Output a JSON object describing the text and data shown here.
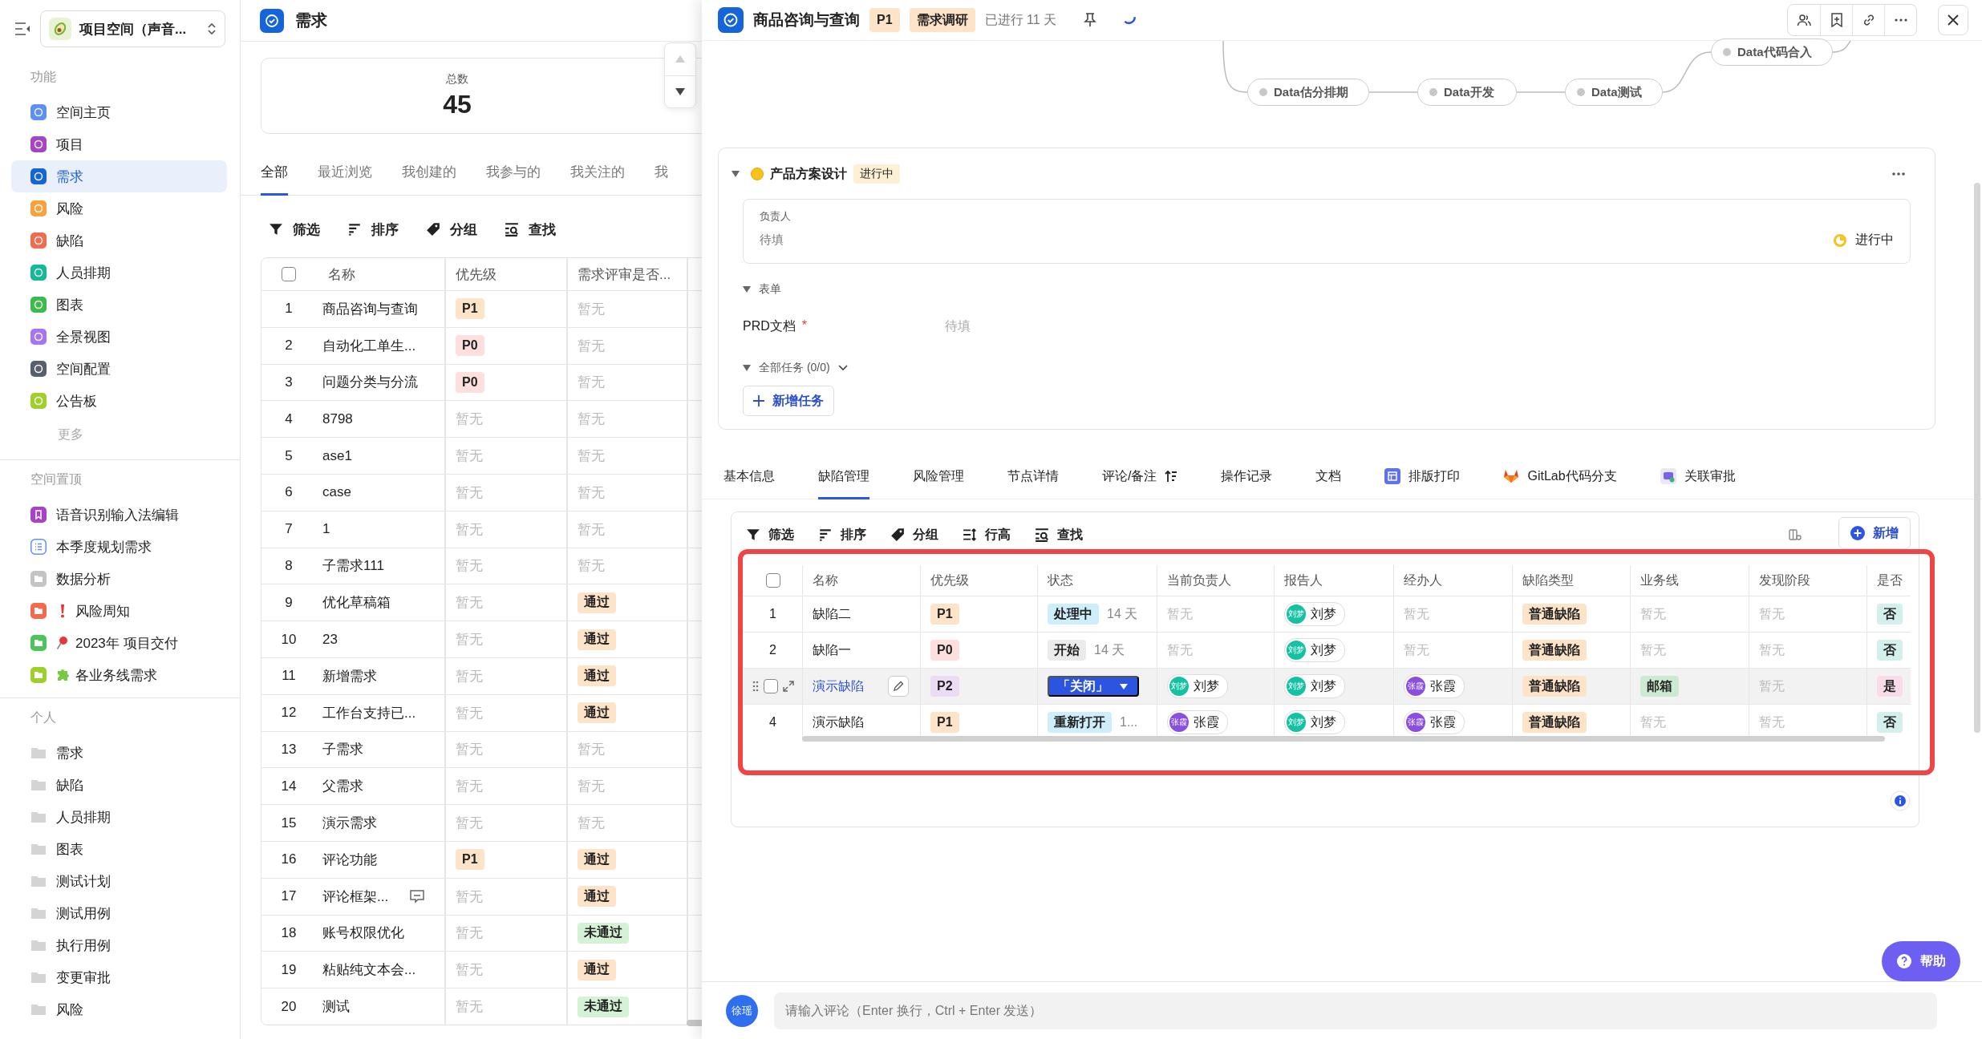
{
  "sidebar": {
    "space_selector": "项目空间（声音...",
    "sections": [
      {
        "title": "功能",
        "more": "更多",
        "items": [
          {
            "label": "空间主页",
            "kind": "tile",
            "color": "#5b8ff9",
            "selected": false
          },
          {
            "label": "项目",
            "kind": "tile",
            "color": "#a446c4",
            "selected": false
          },
          {
            "label": "需求",
            "kind": "tile",
            "color": "#1664d9",
            "selected": true
          },
          {
            "label": "风险",
            "kind": "tile",
            "color": "#f7a23b",
            "selected": false
          },
          {
            "label": "缺陷",
            "kind": "tile",
            "color": "#f26b4f",
            "selected": false
          },
          {
            "label": "人员排期",
            "kind": "tile",
            "color": "#17b89a",
            "selected": false
          },
          {
            "label": "图表",
            "kind": "tile",
            "color": "#3dbb4a",
            "selected": false
          },
          {
            "label": "全景视图",
            "kind": "tile",
            "color": "#a775f2",
            "selected": false
          },
          {
            "label": "空间配置",
            "kind": "tile",
            "color": "#555f6d",
            "selected": false
          },
          {
            "label": "公告板",
            "kind": "tile",
            "color": "#9fcf2b",
            "selected": false
          }
        ]
      },
      {
        "title": "空间置顶",
        "items": [
          {
            "label": "语音识别输入法编辑",
            "kind": "bookmark",
            "color": "#a446c4"
          },
          {
            "label": "本季度规划需求",
            "kind": "list",
            "color": "#5b8ff9"
          },
          {
            "label": "数据分析",
            "kind": "folder",
            "color": "#c4c4c4"
          },
          {
            "label": "风险周知",
            "kind": "folder",
            "color": "#f26b4f",
            "badge": {
              "kind": "exclamation"
            }
          },
          {
            "label": "2023年 项目交付",
            "kind": "folder",
            "color": "#4cc35c",
            "badge": {
              "kind": "pin"
            }
          },
          {
            "label": "各业务线需求",
            "kind": "folder",
            "color": "#9fcf2b",
            "badge": {
              "kind": "puzzle"
            }
          }
        ]
      },
      {
        "title": "个人",
        "items": [
          {
            "label": "需求",
            "kind": "folder"
          },
          {
            "label": "缺陷",
            "kind": "folder"
          },
          {
            "label": "人员排期",
            "kind": "folder"
          },
          {
            "label": "图表",
            "kind": "folder"
          },
          {
            "label": "测试计划",
            "kind": "folder"
          },
          {
            "label": "测试用例",
            "kind": "folder"
          },
          {
            "label": "执行用例",
            "kind": "folder"
          },
          {
            "label": "变更审批",
            "kind": "folder"
          },
          {
            "label": "风险",
            "kind": "folder"
          }
        ]
      }
    ]
  },
  "requirements": {
    "title": "需求",
    "stat": {
      "label": "总数",
      "value": "45"
    },
    "stepper": {
      "up_disabled": true,
      "down_disabled": false
    },
    "tabs": [
      {
        "label": "全部",
        "selected": true
      },
      {
        "label": "最近浏览",
        "selected": false
      },
      {
        "label": "我创建的",
        "selected": false
      },
      {
        "label": "我参与的",
        "selected": false
      },
      {
        "label": "我关注的",
        "selected": false
      },
      {
        "label": "我",
        "selected": false
      }
    ],
    "toolbar": [
      {
        "label": "筛选",
        "kind": "filter"
      },
      {
        "label": "排序",
        "kind": "sort"
      },
      {
        "label": "分组",
        "kind": "group"
      },
      {
        "label": "查找",
        "kind": "find"
      }
    ],
    "table": {
      "select_all_checked": false,
      "columns": [
        "名称",
        "优先级",
        "需求评审是否..."
      ],
      "rows": [
        {
          "no": "1",
          "name": "商品咨询与查询",
          "priority": {
            "text": "P1",
            "kind": "p1"
          },
          "review": {
            "text": "暂无",
            "kind": "empty"
          },
          "comment": false
        },
        {
          "no": "2",
          "name": "自动化工单生...",
          "priority": {
            "text": "P0",
            "kind": "p0"
          },
          "review": {
            "text": "暂无",
            "kind": "empty"
          },
          "comment": false
        },
        {
          "no": "3",
          "name": "问题分类与分流",
          "priority": {
            "text": "P0",
            "kind": "p0"
          },
          "review": {
            "text": "暂无",
            "kind": "empty"
          },
          "comment": false
        },
        {
          "no": "4",
          "name": "8798",
          "priority": {
            "text": "暂无",
            "kind": "empty"
          },
          "review": {
            "text": "暂无",
            "kind": "empty"
          },
          "comment": false
        },
        {
          "no": "5",
          "name": "ase1",
          "priority": {
            "text": "暂无",
            "kind": "empty"
          },
          "review": {
            "text": "暂无",
            "kind": "empty"
          },
          "comment": false
        },
        {
          "no": "6",
          "name": "case",
          "priority": {
            "text": "暂无",
            "kind": "empty"
          },
          "review": {
            "text": "暂无",
            "kind": "empty"
          },
          "comment": false
        },
        {
          "no": "7",
          "name": "1",
          "priority": {
            "text": "暂无",
            "kind": "empty"
          },
          "review": {
            "text": "暂无",
            "kind": "empty"
          },
          "comment": false
        },
        {
          "no": "8",
          "name": "子需求111",
          "priority": {
            "text": "暂无",
            "kind": "empty"
          },
          "review": {
            "text": "暂无",
            "kind": "empty"
          },
          "comment": false
        },
        {
          "no": "9",
          "name": "优化草稿箱",
          "priority": {
            "text": "暂无",
            "kind": "empty"
          },
          "review": {
            "text": "通过",
            "kind": "pass"
          },
          "comment": false
        },
        {
          "no": "10",
          "name": "23",
          "priority": {
            "text": "暂无",
            "kind": "empty"
          },
          "review": {
            "text": "通过",
            "kind": "pass"
          },
          "comment": false
        },
        {
          "no": "11",
          "name": "新增需求",
          "priority": {
            "text": "暂无",
            "kind": "empty"
          },
          "review": {
            "text": "通过",
            "kind": "pass"
          },
          "comment": false
        },
        {
          "no": "12",
          "name": "工作台支持已...",
          "priority": {
            "text": "暂无",
            "kind": "empty"
          },
          "review": {
            "text": "通过",
            "kind": "pass"
          },
          "comment": false
        },
        {
          "no": "13",
          "name": "子需求",
          "priority": {
            "text": "暂无",
            "kind": "empty"
          },
          "review": {
            "text": "暂无",
            "kind": "empty"
          },
          "comment": false
        },
        {
          "no": "14",
          "name": "父需求",
          "priority": {
            "text": "暂无",
            "kind": "empty"
          },
          "review": {
            "text": "暂无",
            "kind": "empty"
          },
          "comment": false
        },
        {
          "no": "15",
          "name": "演示需求",
          "priority": {
            "text": "暂无",
            "kind": "empty"
          },
          "review": {
            "text": "暂无",
            "kind": "empty"
          },
          "comment": false
        },
        {
          "no": "16",
          "name": "评论功能",
          "priority": {
            "text": "P1",
            "kind": "p1"
          },
          "review": {
            "text": "通过",
            "kind": "pass"
          },
          "comment": false
        },
        {
          "no": "17",
          "name": "评论框架...",
          "priority": {
            "text": "暂无",
            "kind": "empty"
          },
          "review": {
            "text": "通过",
            "kind": "pass"
          },
          "comment": true
        },
        {
          "no": "18",
          "name": "账号权限优化",
          "priority": {
            "text": "暂无",
            "kind": "empty"
          },
          "review": {
            "text": "未通过",
            "kind": "fail"
          },
          "comment": false
        },
        {
          "no": "19",
          "name": "粘贴纯文本会...",
          "priority": {
            "text": "暂无",
            "kind": "empty"
          },
          "review": {
            "text": "通过",
            "kind": "pass"
          },
          "comment": false
        },
        {
          "no": "20",
          "name": "测试",
          "priority": {
            "text": "暂无",
            "kind": "empty"
          },
          "review": {
            "text": "未通过",
            "kind": "fail"
          },
          "comment": false
        }
      ]
    }
  },
  "detail": {
    "title": "商品咨询与查询",
    "priority": "P1",
    "stage": "需求调研",
    "elapsed": "已进行 11 天",
    "flow": [
      {
        "label": "Data估分排期"
      },
      {
        "label": "Data开发"
      },
      {
        "label": "Data测试"
      },
      {
        "label": "Data代码合入"
      }
    ],
    "node_card": {
      "title": "产品方案设计",
      "status": "进行中",
      "owner_label": "负责人",
      "owner_value": "待填",
      "progress": "进行中",
      "form_label": "表单",
      "fields": [
        {
          "label": "PRD文档",
          "required_mark": "*",
          "value": "待填"
        }
      ],
      "tasks_label": "全部任务 (0/0)",
      "add_task": "新增任务"
    },
    "tabs": [
      {
        "label": "基本信息",
        "selected": false
      },
      {
        "label": "缺陷管理",
        "selected": true
      },
      {
        "label": "风险管理",
        "selected": false
      },
      {
        "label": "节点详情",
        "selected": false
      },
      {
        "label": "评论/备注",
        "selected": false,
        "kind": "sort"
      },
      {
        "label": "操作记录",
        "selected": false
      },
      {
        "label": "文档",
        "selected": false
      },
      {
        "label": "排版打印",
        "selected": false,
        "kind": "layout"
      },
      {
        "label": "GitLab代码分支",
        "selected": false,
        "kind": "fox"
      },
      {
        "label": "关联审批",
        "selected": false,
        "kind": "approval"
      }
    ],
    "defects": {
      "toolbar": [
        {
          "label": "筛选",
          "kind": "filter"
        },
        {
          "label": "排序",
          "kind": "sort"
        },
        {
          "label": "分组",
          "kind": "group"
        },
        {
          "label": "行高",
          "kind": "rowheight"
        },
        {
          "label": "查找",
          "kind": "find"
        }
      ],
      "add_button": "新增",
      "select_all_checked": false,
      "columns": [
        "名称",
        "优先级",
        "状态",
        "当前负责人",
        "报告人",
        "经办人",
        "缺陷类型",
        "业务线",
        "发现阶段",
        "是否"
      ],
      "rows": [
        {
          "no": "1",
          "hovered": false,
          "name": "缺陷二",
          "priority": {
            "text": "P1",
            "kind": "p1"
          },
          "status": {
            "text": "处理中",
            "kind": "processing",
            "duration": "14 天"
          },
          "owner": {
            "text": "暂无",
            "kind": "empty"
          },
          "reporter": {
            "text": "刘梦",
            "kind": "person",
            "avatar": "刘梦",
            "color": "#14c2a3"
          },
          "handler": {
            "text": "暂无",
            "kind": "empty"
          },
          "type": {
            "text": "普通缺陷",
            "kind": "type"
          },
          "line": {
            "text": "暂无",
            "kind": "empty"
          },
          "phase": {
            "text": "暂无",
            "kind": "empty"
          },
          "flag": {
            "text": "否",
            "kind": "no"
          }
        },
        {
          "no": "2",
          "hovered": false,
          "name": "缺陷一",
          "priority": {
            "text": "P0",
            "kind": "p0"
          },
          "status": {
            "text": "开始",
            "kind": "start",
            "duration": "14 天"
          },
          "owner": {
            "text": "暂无",
            "kind": "empty"
          },
          "reporter": {
            "text": "刘梦",
            "kind": "person",
            "avatar": "刘梦",
            "color": "#14c2a3"
          },
          "handler": {
            "text": "暂无",
            "kind": "empty"
          },
          "type": {
            "text": "普通缺陷",
            "kind": "type"
          },
          "line": {
            "text": "暂无",
            "kind": "empty"
          },
          "phase": {
            "text": "暂无",
            "kind": "empty"
          },
          "flag": {
            "text": "否",
            "kind": "no"
          }
        },
        {
          "hovered": true,
          "checked": false,
          "name": "演示缺陷",
          "priority": {
            "text": "P2",
            "kind": "p2"
          },
          "status": {
            "text": "「关闭」",
            "kind": "dropdown"
          },
          "owner": {
            "text": "刘梦",
            "kind": "person",
            "avatar": "刘梦",
            "color": "#14c2a3"
          },
          "reporter": {
            "text": "刘梦",
            "kind": "person",
            "avatar": "刘梦",
            "color": "#14c2a3"
          },
          "handler": {
            "text": "张霞",
            "kind": "person",
            "avatar": "张霞",
            "color": "#8a4fe0"
          },
          "type": {
            "text": "普通缺陷",
            "kind": "type"
          },
          "line": {
            "text": "邮箱",
            "kind": "line"
          },
          "phase": {
            "text": "暂无",
            "kind": "empty"
          },
          "flag": {
            "text": "是",
            "kind": "yes"
          }
        },
        {
          "no": "4",
          "hovered": false,
          "name": "演示缺陷",
          "priority": {
            "text": "P1",
            "kind": "p1"
          },
          "status": {
            "text": "重新打开",
            "kind": "reopen",
            "duration": "1..."
          },
          "owner": {
            "text": "张霞",
            "kind": "person",
            "avatar": "张霞",
            "color": "#8a4fe0"
          },
          "reporter": {
            "text": "刘梦",
            "kind": "person",
            "avatar": "刘梦",
            "color": "#14c2a3"
          },
          "handler": {
            "text": "张霞",
            "kind": "person",
            "avatar": "张霞",
            "color": "#8a4fe0"
          },
          "type": {
            "text": "普通缺陷",
            "kind": "type"
          },
          "line": {
            "text": "暂无",
            "kind": "empty"
          },
          "phase": {
            "text": "暂无",
            "kind": "empty"
          },
          "flag": {
            "text": "否",
            "kind": "no"
          }
        }
      ]
    },
    "help": "帮助",
    "comment": {
      "avatar": "徐瑶",
      "placeholder": "请输入评论（Enter 换行，Ctrl + Enter 发送）"
    }
  }
}
